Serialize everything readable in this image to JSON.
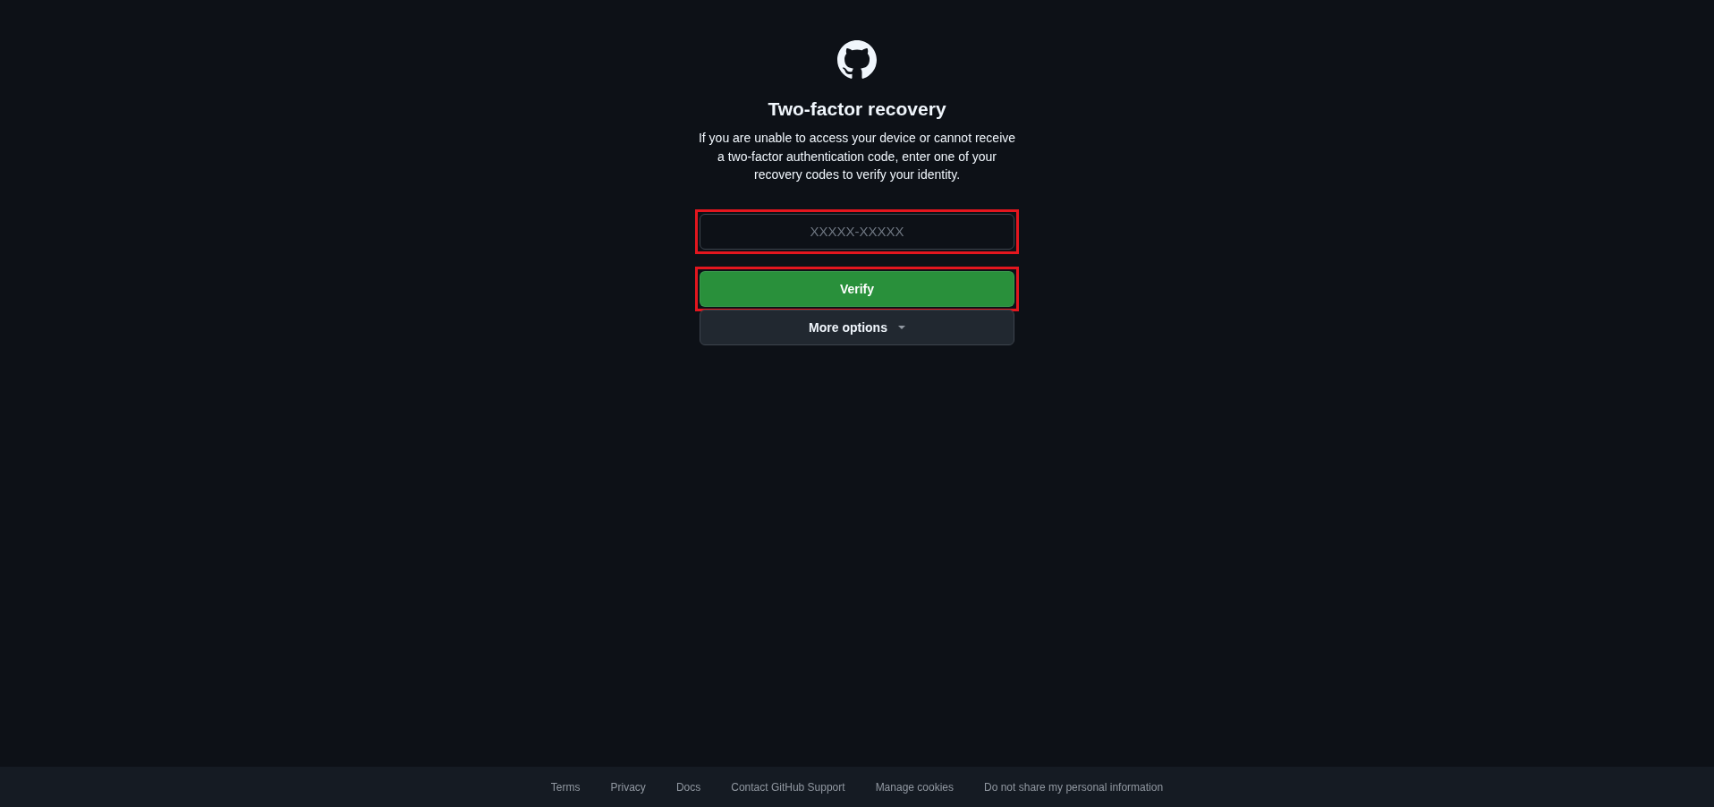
{
  "heading": "Two-factor recovery",
  "description": "If you are unable to access your device or cannot receive a two-factor authentication code, enter one of your recovery codes to verify your identity.",
  "code_input": {
    "placeholder": "XXXXX-XXXXX",
    "highlighted": true
  },
  "buttons": [
    {
      "label": "Verify",
      "kind": "primary",
      "highlighted": true
    },
    {
      "label": "More options",
      "kind": "dropdown",
      "highlighted": false
    }
  ],
  "footer": {
    "links": [
      "Terms",
      "Privacy",
      "Docs",
      "Contact GitHub Support",
      "Manage cookies",
      "Do not share my personal information"
    ]
  }
}
